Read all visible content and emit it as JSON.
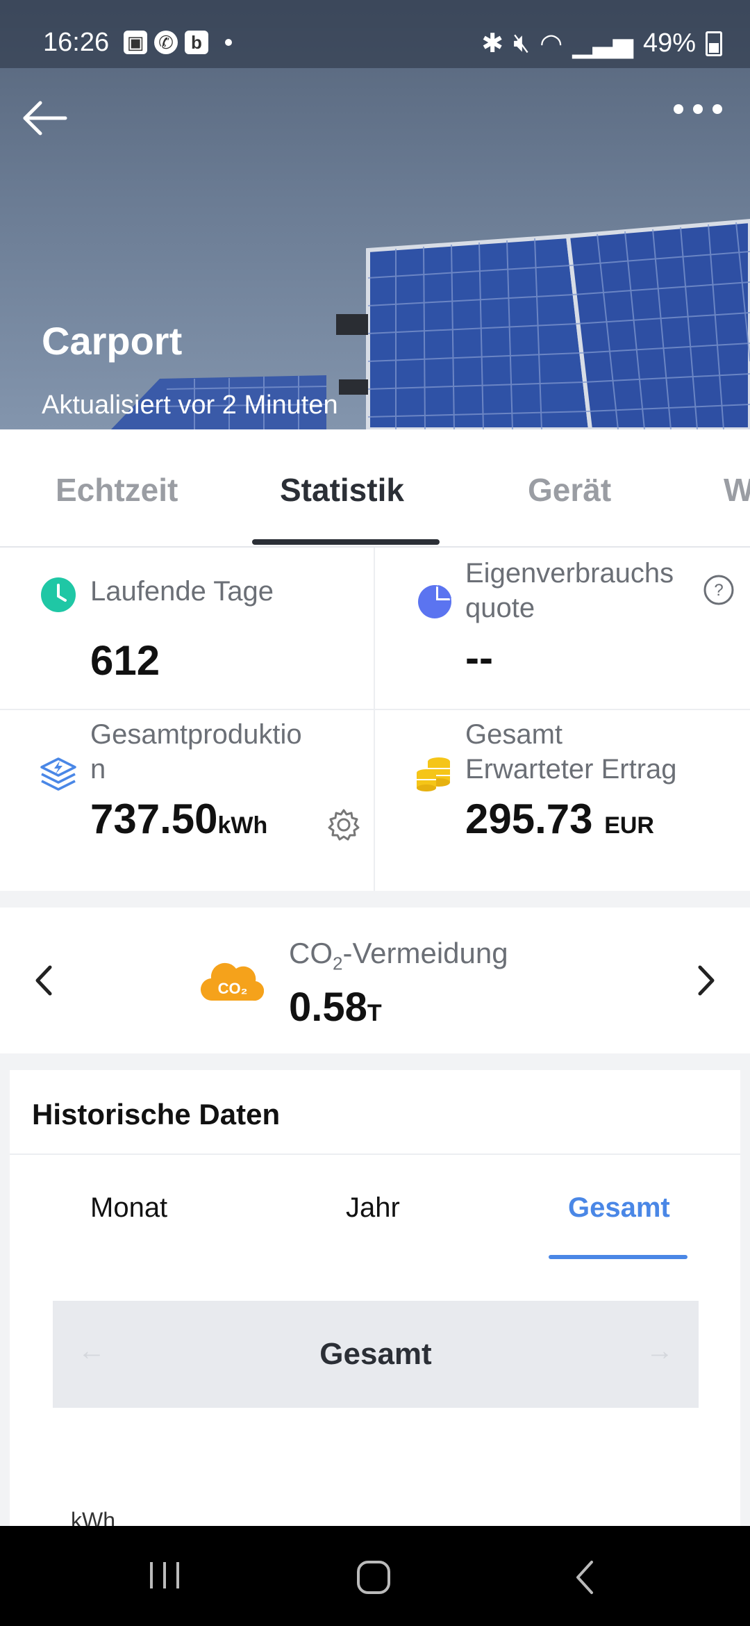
{
  "status_bar": {
    "time": "16:26",
    "battery": "49%",
    "app_icons": [
      "image-icon",
      "whatsapp-icon",
      "b-icon"
    ]
  },
  "header": {
    "title": "Carport",
    "subtitle": "Aktualisiert vor 2 Minuten"
  },
  "tabs": [
    {
      "label": "Echtzeit",
      "active": false
    },
    {
      "label": "Statistik",
      "active": true
    },
    {
      "label": "Gerät",
      "active": false
    },
    {
      "label": "W",
      "active": false
    }
  ],
  "stats": {
    "running_days": {
      "label": "Laufende Tage",
      "value": "612"
    },
    "self_consumption": {
      "label_line1": "Eigenverbrauchs",
      "label_line2": "quote",
      "value": "--"
    },
    "total_production": {
      "label_line1": "Gesamtproduktio",
      "label_line2": "n",
      "value": "737.50",
      "unit": "kWh"
    },
    "expected_yield": {
      "label_line1": "Gesamt",
      "label_line2": "Erwarteter Ertrag",
      "value": "295.73",
      "unit": "EUR"
    }
  },
  "co2": {
    "label_prefix": "CO",
    "label_sub": "2",
    "label_suffix": "-Vermeidung",
    "badge": "CO₂",
    "value": "0.58",
    "unit": "T"
  },
  "history": {
    "title": "Historische Daten",
    "tabs": [
      {
        "label": "Monat",
        "active": false
      },
      {
        "label": "Jahr",
        "active": false
      },
      {
        "label": "Gesamt",
        "active": true
      }
    ],
    "period_label": "Gesamt",
    "axis_unit": "kWh"
  },
  "colors": {
    "accent_blue": "#4a87e6",
    "teal": "#1fc7a5",
    "co2_orange": "#f5a21b",
    "coin_yellow": "#f5c518",
    "pie_blue": "#5b74f0"
  }
}
